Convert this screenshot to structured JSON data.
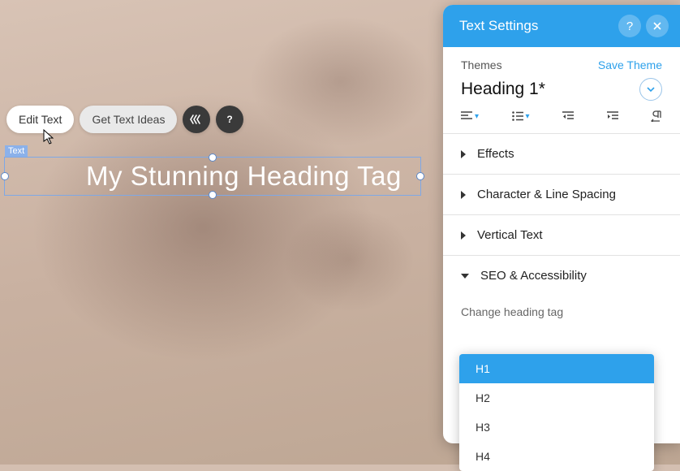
{
  "canvas": {
    "element_label": "Text",
    "heading_text": "My Stunning Heading Tag"
  },
  "toolbar": {
    "edit_text": "Edit Text",
    "get_ideas": "Get Text Ideas"
  },
  "panel": {
    "title": "Text Settings",
    "themes_label": "Themes",
    "save_theme": "Save Theme",
    "theme_name": "Heading 1*",
    "sections": {
      "effects": "Effects",
      "spacing": "Character & Line Spacing",
      "vertical": "Vertical Text",
      "seo": "SEO & Accessibility"
    },
    "change_tag_label": "Change heading tag",
    "heading_options": [
      "H1",
      "H2",
      "H3",
      "H4"
    ],
    "heading_selected": "H1"
  }
}
